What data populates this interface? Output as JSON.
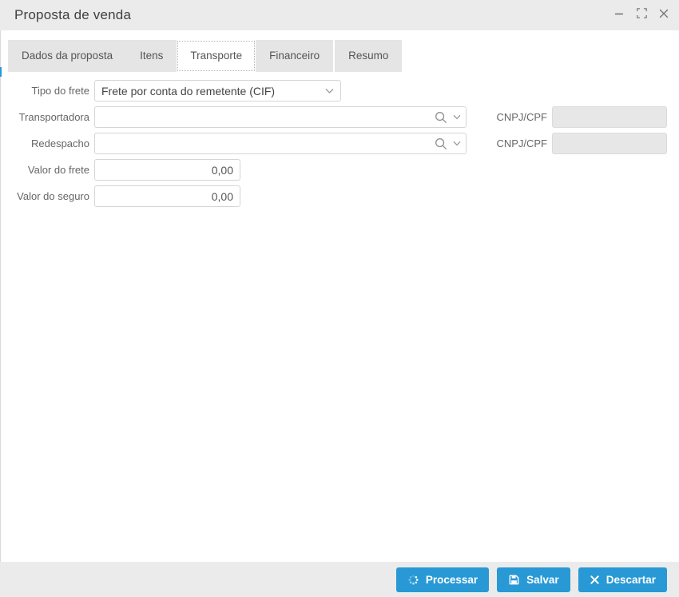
{
  "window": {
    "title": "Proposta de venda"
  },
  "icons": {
    "titlebar": [
      "minimize-icon",
      "maximize-icon",
      "close-icon"
    ],
    "combo": [
      "search-icon",
      "chevron-down-icon"
    ],
    "select": "chevron-down-icon",
    "buttons": [
      "spinner-icon",
      "save-icon",
      "x-icon"
    ]
  },
  "tabs": [
    {
      "label": "Dados da proposta",
      "active": false
    },
    {
      "label": "Itens",
      "active": false
    },
    {
      "label": "Transporte",
      "active": true
    },
    {
      "label": "Financeiro",
      "active": false
    },
    {
      "label": "Resumo",
      "active": false
    }
  ],
  "form": {
    "freight_type": {
      "label": "Tipo do frete",
      "value": "Frete por conta do remetente (CIF)"
    },
    "carrier": {
      "label": "Transportadora",
      "value": "",
      "doc_label": "CNPJ/CPF",
      "doc_value": ""
    },
    "redispatch": {
      "label": "Redespacho",
      "value": "",
      "doc_label": "CNPJ/CPF",
      "doc_value": ""
    },
    "freight_value": {
      "label": "Valor do frete",
      "value": "0,00"
    },
    "insurance_value": {
      "label": "Valor do seguro",
      "value": "0,00"
    }
  },
  "footer": {
    "process_label": "Processar",
    "save_label": "Salvar",
    "discard_label": "Descartar"
  },
  "colors": {
    "accent": "#2899d5",
    "titlebar_bg": "#ebebeb",
    "tab_bg": "#e5e5e5",
    "footer_bg": "#ebebeb",
    "input_border": "#d5d5d5",
    "disabled_input_bg": "#e7e7e7"
  }
}
